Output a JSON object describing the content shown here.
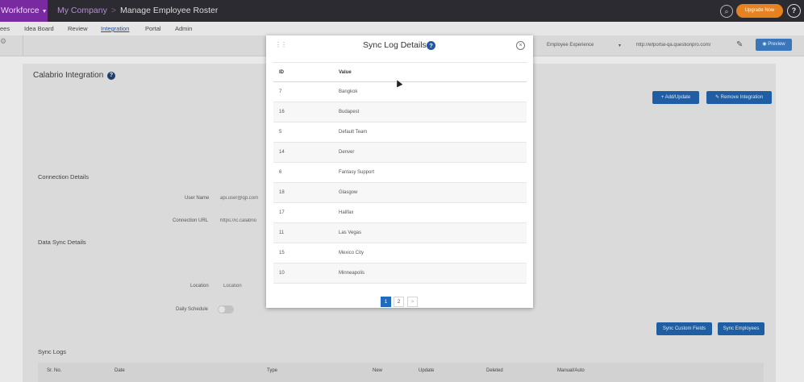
{
  "header": {
    "brand": "Workforce",
    "breadcrumb_company": "My Company",
    "breadcrumb_separator": ">",
    "breadcrumb_page": "Manage Employee Roster",
    "upgrade_label": "Upgrade Now",
    "help_label": "?",
    "icons": [
      "search-icon",
      "caret-down-icon"
    ]
  },
  "nav": {
    "items": [
      "ees",
      "Idea Board",
      "Review",
      "Integration",
      "Portal",
      "Admin"
    ],
    "active": "Integration"
  },
  "toolbar": {
    "experience": "Employee Experience",
    "url": "http://wfportal-qa.questionpro.com/",
    "preview_label": "Preview",
    "preview_icon": "eye-icon"
  },
  "page": {
    "title": "Calabrio Integration",
    "add_update_label": "+ Add/Update",
    "remove_label": "Remove Integration",
    "connection_section": "Connection Details",
    "user_name_label": "User Name",
    "user_name_value": "api.user@qp.com",
    "connection_url_label": "Connection URL",
    "connection_url_value": "https://ic.calabrio",
    "data_sync_section": "Data Sync Details",
    "location_label": "Location",
    "location_value": "Location",
    "daily_schedule_label": "Daily Schedule",
    "daily_schedule_on": false,
    "sync_custom_fields_label": "Sync Custom Fields",
    "sync_employees_label": "Sync Employees",
    "sync_logs_section": "Sync Logs",
    "sync_log_columns": [
      "Sr. No.",
      "Date",
      "Type",
      "New",
      "Update",
      "Deleted",
      "Manual/Auto"
    ]
  },
  "modal": {
    "title": "Sync Log Details",
    "columns": [
      "ID",
      "Value"
    ],
    "rows": [
      {
        "id": "7",
        "value": "Bangkok"
      },
      {
        "id": "16",
        "value": "Budapest"
      },
      {
        "id": "5",
        "value": "Default Team"
      },
      {
        "id": "14",
        "value": "Denver"
      },
      {
        "id": "6",
        "value": "Fantasy Support"
      },
      {
        "id": "18",
        "value": "Glasgow"
      },
      {
        "id": "17",
        "value": "Halifax"
      },
      {
        "id": "11",
        "value": "Las Vegas"
      },
      {
        "id": "15",
        "value": "Mexico City"
      },
      {
        "id": "10",
        "value": "Minneapolis"
      }
    ],
    "pages": [
      "1",
      "2"
    ],
    "current_page": "1",
    "next_label": ">"
  },
  "colors": {
    "brand_purple": "#7a2aa0",
    "topbar": "#2d2b32",
    "primary_blue": "#1f5ea3",
    "upgrade_orange": "#e6821f"
  }
}
